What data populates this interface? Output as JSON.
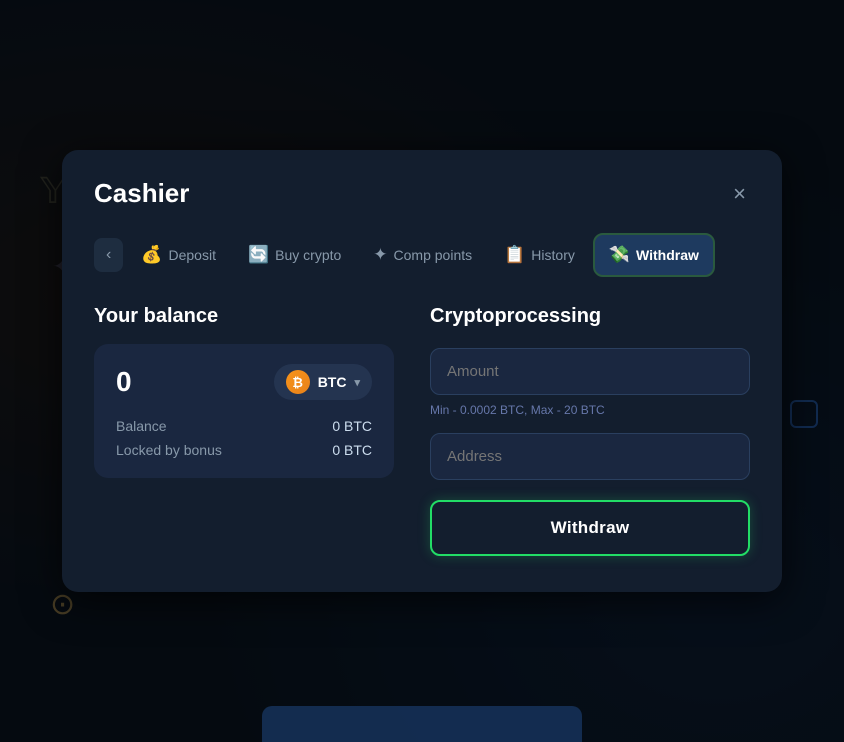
{
  "modal": {
    "title": "Cashier",
    "close_label": "×"
  },
  "tabs": {
    "back_arrow": "‹",
    "items": [
      {
        "id": "deposit",
        "label": "Deposit",
        "icon": "💰",
        "active": false
      },
      {
        "id": "buy-crypto",
        "label": "Buy crypto",
        "icon": "🔄",
        "active": false
      },
      {
        "id": "comp-points",
        "label": "Comp points",
        "icon": "✦",
        "active": false
      },
      {
        "id": "history",
        "label": "History",
        "icon": "📋",
        "active": false
      },
      {
        "id": "withdraw",
        "label": "Withdraw",
        "icon": "💸",
        "active": true
      }
    ]
  },
  "balance_section": {
    "title": "Your balance",
    "amount": "0",
    "currency_symbol": "BTC",
    "rows": [
      {
        "label": "Balance",
        "value": "0 BTC"
      },
      {
        "label": "Locked by bonus",
        "value": "0 BTC"
      }
    ]
  },
  "crypto_section": {
    "title": "Cryptoprocessing",
    "amount_placeholder": "Amount",
    "amount_hint": "Min - 0.0002 BTC, Max - 20 BTC",
    "address_placeholder": "Address",
    "withdraw_button_label": "Withdraw"
  }
}
